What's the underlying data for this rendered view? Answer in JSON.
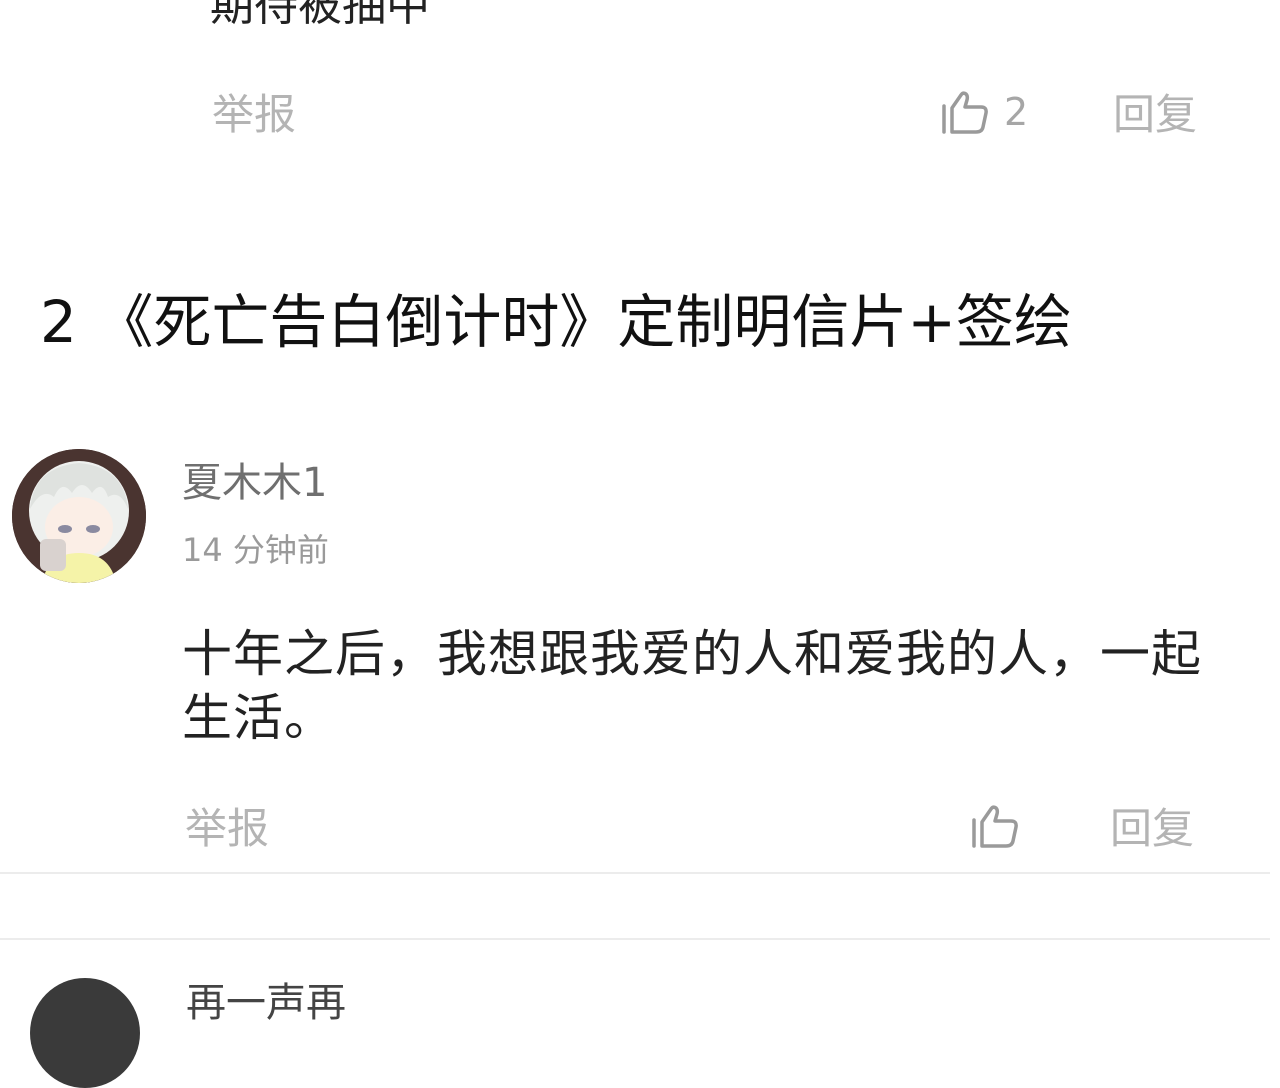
{
  "previous_comment": {
    "body_text": "期待被抽中",
    "report_label": "举报",
    "like_count": "2",
    "reply_label": "回复",
    "icons": {
      "like": "thumbs-up-icon"
    }
  },
  "section": {
    "title": "2 《死亡告白倒计时》定制明信片+签绘"
  },
  "comment": {
    "username": "夏木木1",
    "timestamp": "14 分钟前",
    "body": "十年之后，我想跟我爱的人和爱我的人，一起生活。",
    "report_label": "举报",
    "reply_label": "回复",
    "icons": {
      "like": "thumbs-up-icon"
    }
  },
  "next_comment": {
    "username": "再一声再"
  },
  "colors": {
    "muted_text": "#b4b4b4",
    "divider": "#ececec",
    "title_text": "#111111"
  }
}
